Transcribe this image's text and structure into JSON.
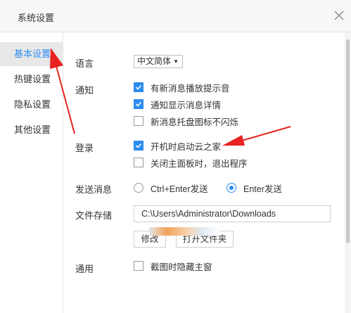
{
  "window": {
    "title": "系统设置",
    "close_icon": "close-icon"
  },
  "sidebar": {
    "items": [
      {
        "label": "基本设置",
        "active": true
      },
      {
        "label": "热键设置",
        "active": false
      },
      {
        "label": "隐私设置",
        "active": false
      },
      {
        "label": "其他设置",
        "active": false
      }
    ]
  },
  "settings": {
    "language": {
      "label": "语言",
      "value": "中文简体"
    },
    "notify": {
      "label": "通知",
      "options": [
        {
          "text": "有新消息播放提示音",
          "checked": true
        },
        {
          "text": "通知显示消息详情",
          "checked": true
        },
        {
          "text": "新消息托盘图标不闪烁",
          "checked": false
        }
      ]
    },
    "login": {
      "label": "登录",
      "options": [
        {
          "text": "开机时启动云之家",
          "checked": true
        },
        {
          "text": "关闭主面板时，退出程序",
          "checked": false
        }
      ]
    },
    "send": {
      "label": "发送消息",
      "options": [
        {
          "text": "Ctrl+Enter发送",
          "selected": false
        },
        {
          "text": "Enter发送",
          "selected": true
        }
      ]
    },
    "storage": {
      "label": "文件存储",
      "path": "C:\\Users\\Administrator\\Downloads",
      "modify_button": "修改",
      "open_button": "打开文件夹"
    },
    "general": {
      "label": "通用",
      "option": {
        "text": "截图时隐藏主窗",
        "checked": false
      }
    }
  },
  "colors": {
    "accent": "#2d8cf0",
    "annotation_arrow": "#e8231f",
    "active_item_bg": "#e8e8e8"
  }
}
